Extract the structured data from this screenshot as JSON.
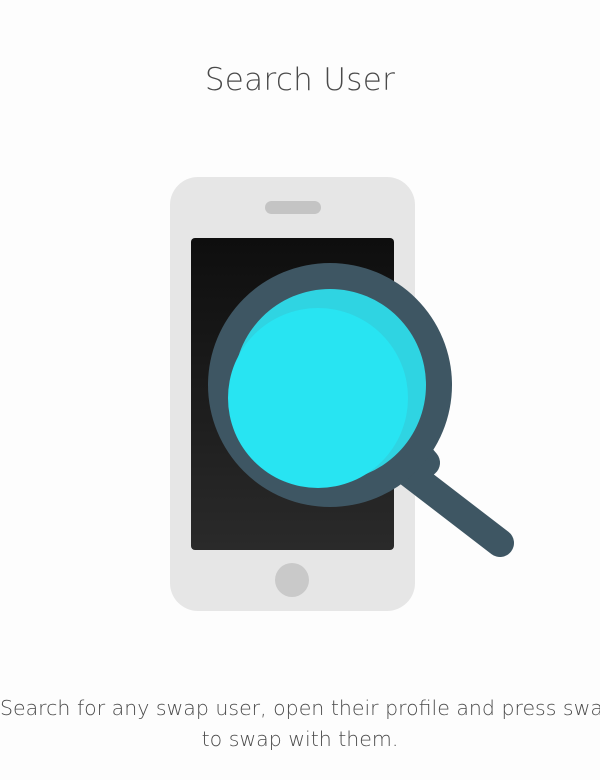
{
  "page": {
    "title": "Search User",
    "description_lines": [
      "Search for any swap user, open their profile and press swap",
      "to swap with them."
    ]
  },
  "illustration": {
    "icon": "phone-with-magnifier-icon",
    "colors": {
      "phone_body": "#e6e6e6",
      "phone_screen": "#1b1b1b",
      "phone_speaker": "#c4c4c4",
      "home_button": "#c9c9c9",
      "magnifier_frame": "#3e5663",
      "magnifier_lens": "#28e0f0",
      "lens_highlight": "#2fd4e2"
    }
  },
  "colors": {
    "background": "#fdfdfd",
    "text": "#4a4a4a"
  }
}
